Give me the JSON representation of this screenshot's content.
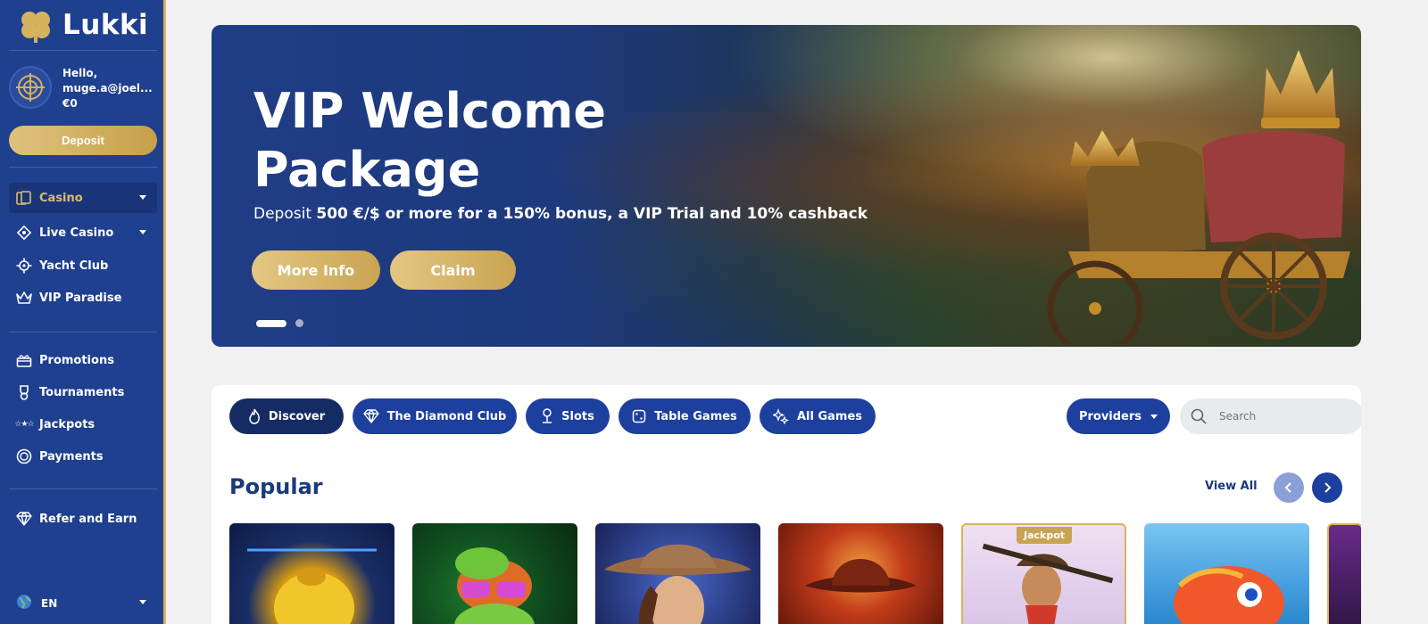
{
  "brand": {
    "name": "Lukki"
  },
  "user": {
    "greeting": "Hello,",
    "email": "muge.a@joel...",
    "balance": "€0"
  },
  "sidebar": {
    "deposit_label": "Deposit",
    "primary_nav": [
      {
        "label": "Casino",
        "icon": "cards-icon",
        "active": true,
        "expandable": true
      },
      {
        "label": "Live Casino",
        "icon": "diamond-outline-icon",
        "expandable": true
      },
      {
        "label": "Yacht Club",
        "icon": "helm-icon"
      },
      {
        "label": "VIP Paradise",
        "icon": "crown-icon"
      }
    ],
    "secondary_nav": [
      {
        "label": "Promotions",
        "icon": "gift-icon"
      },
      {
        "label": "Tournaments",
        "icon": "trophy-icon"
      },
      {
        "label": "Jackpots",
        "icon": "stars-icon"
      },
      {
        "label": "Payments",
        "icon": "coin-icon"
      }
    ],
    "refer_label": "Refer and Earn",
    "language": "EN"
  },
  "banner": {
    "title_line1": "VIP Welcome",
    "title_line2": "Package",
    "sub_prefix": "Deposit ",
    "sub_bold": "500 €/$ or more for a 150% bonus, a VIP Trial and 10% cashback",
    "more_info_label": "More Info",
    "claim_label": "Claim",
    "slide_index": 1,
    "slide_count": 2
  },
  "games": {
    "categories": [
      {
        "label": "Discover",
        "icon": "flame-icon",
        "active": true
      },
      {
        "label": "The Diamond Club",
        "icon": "diamond-icon"
      },
      {
        "label": "Slots",
        "icon": "joystick-icon"
      },
      {
        "label": "Table Games",
        "icon": "dice-icon"
      },
      {
        "label": "All Games",
        "icon": "sparkle-icon"
      }
    ],
    "providers_label": "Providers",
    "search_placeholder": "Search",
    "section_title": "Popular",
    "view_all_label": "View All",
    "jackpot_tag": "Jackpot"
  },
  "colors": {
    "sidebar": "#1f3f8f",
    "gold": "#c9a452",
    "accent_blue": "#1d3f9d",
    "dark_blue": "#152b63"
  }
}
